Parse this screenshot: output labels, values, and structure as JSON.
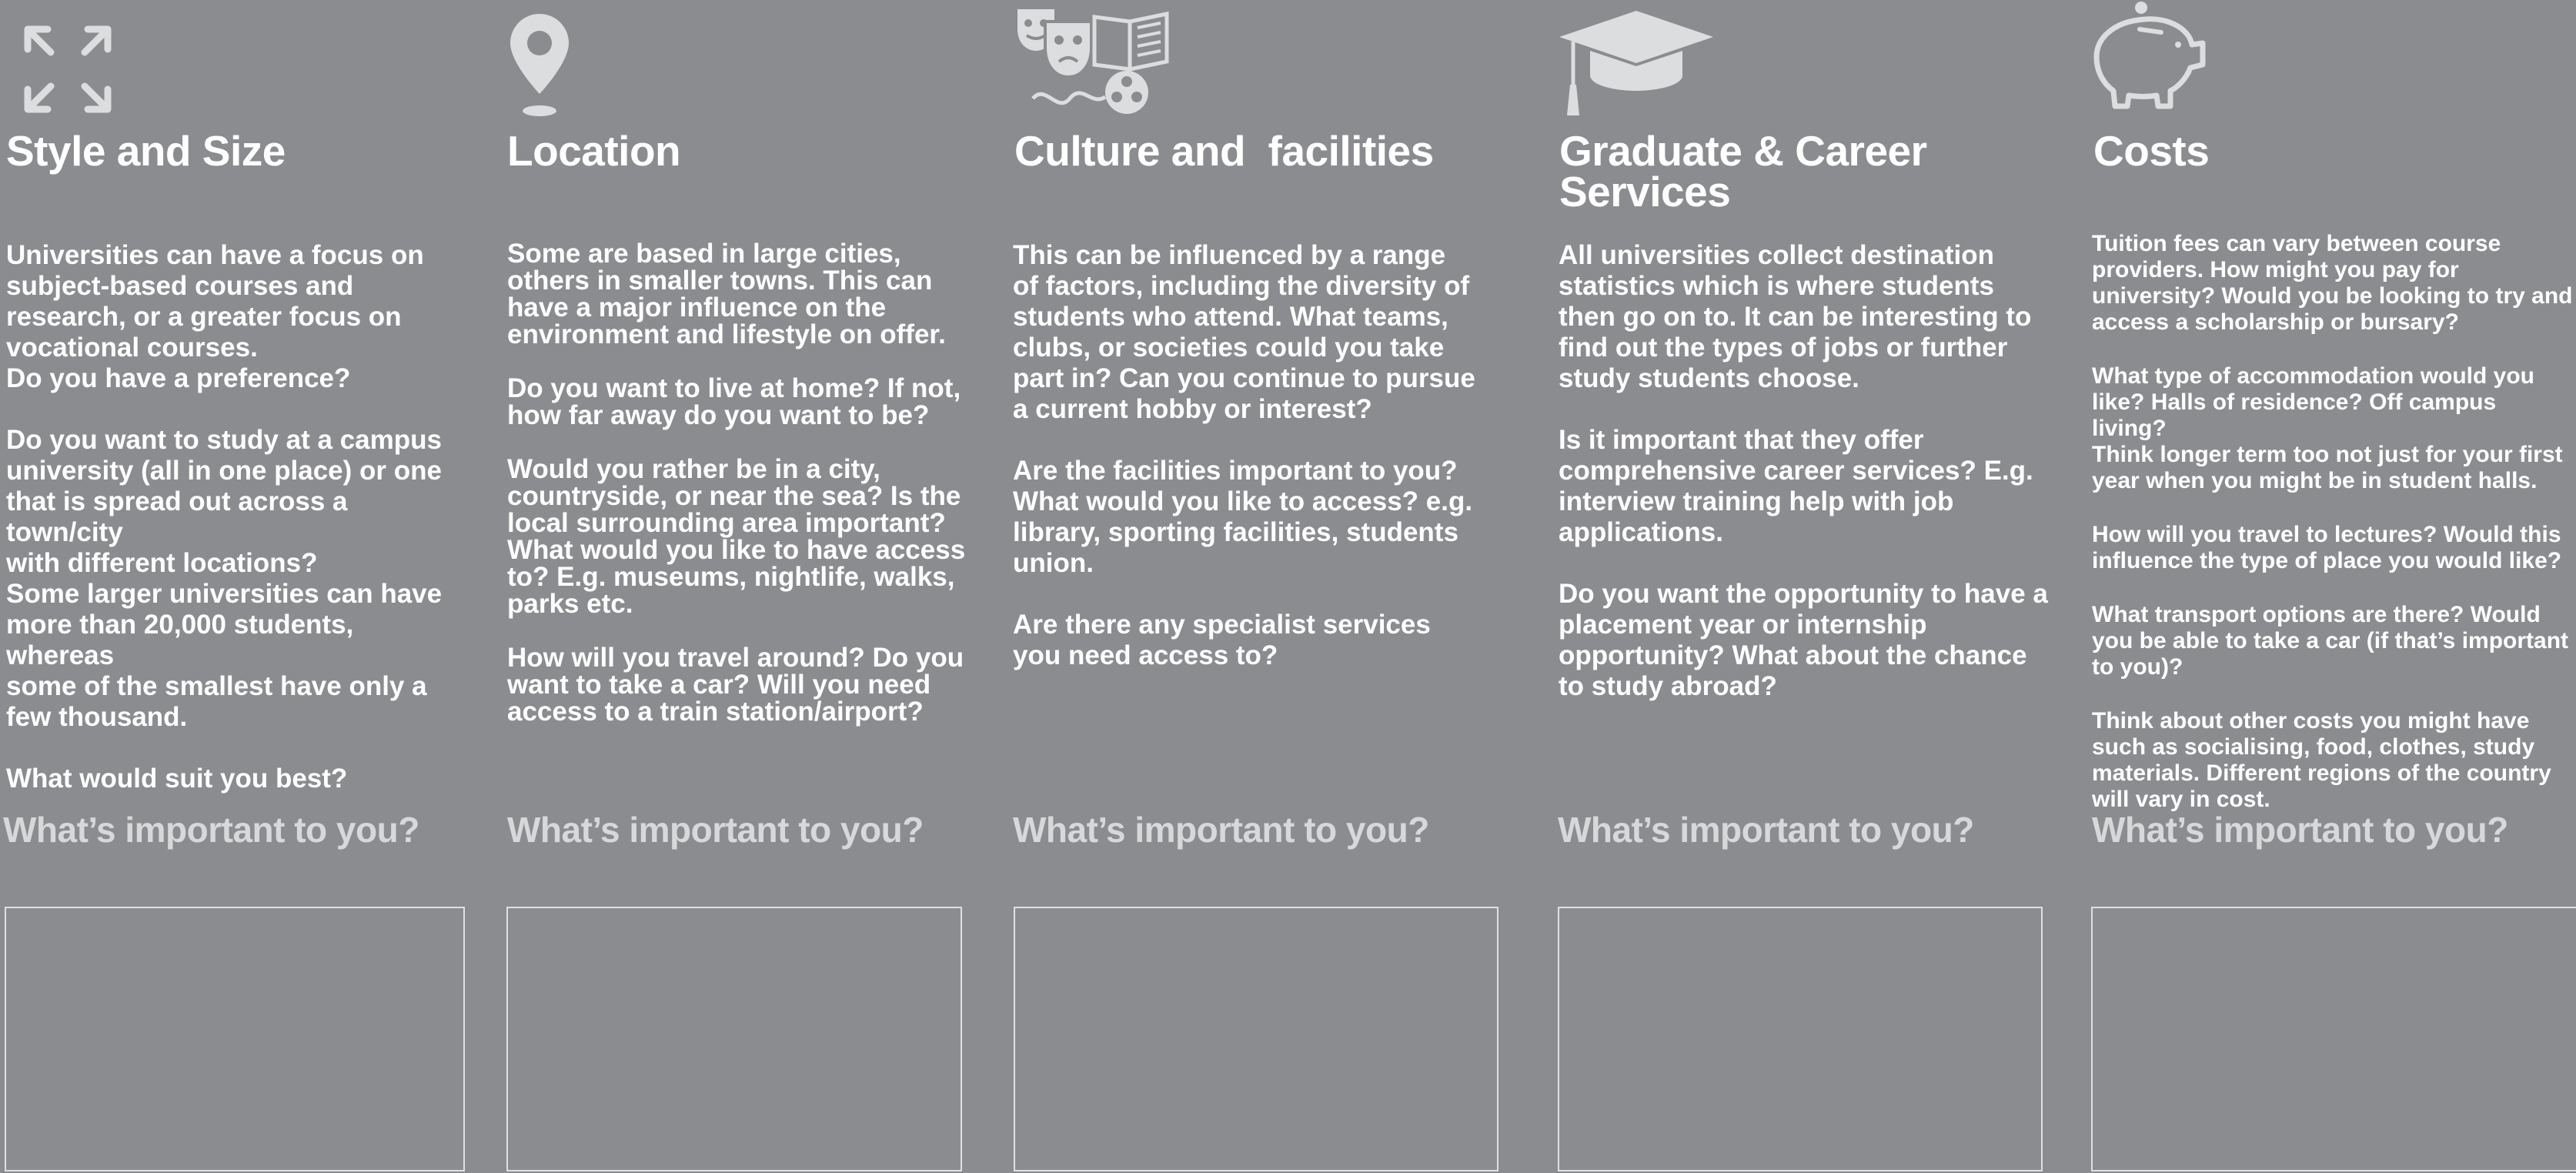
{
  "colors": {
    "background": "#8b8c8f",
    "icon": "#dcdddf",
    "question": "#d7d8da",
    "box_border": "#dfe0e2"
  },
  "columns": [
    {
      "icon": "expand-arrows-icon",
      "title": "Style and Size",
      "paragraphs": [
        "Universities can have a focus on\nsubject-based courses and\nresearch, or a greater focus on\nvocational courses.\nDo you have a preference?",
        "Do you want to study at a campus\nuniversity (all in one place) or one\nthat is spread out across a town/city\nwith different locations?\nSome larger universities can have\nmore than 20,000 students, whereas\nsome of the smallest have only a\nfew thousand.",
        "What would suit you best?"
      ],
      "question": "What’s important to you?"
    },
    {
      "icon": "map-pin-icon",
      "title": "Location",
      "paragraphs": [
        "Some are based in large cities,\nothers in smaller towns. This can\nhave a major influence on the\nenvironment and lifestyle on offer.",
        "Do you want to live at home? If not,\nhow far away do you want to be?",
        "Would you rather be in a city,\ncountryside, or near the sea? Is the\nlocal surrounding area important?\nWhat would you like to have access\nto? E.g. museums, nightlife, walks,\nparks etc.",
        "How will you travel around? Do you\nwant to take a car? Will you need\naccess to a train station/airport?"
      ],
      "question": "What’s important to you?"
    },
    {
      "icon": "culture-masks-film-book-icon",
      "title": "Culture and  facilities",
      "paragraphs": [
        "This can be influenced by a range\nof factors, including the diversity of\nstudents who attend. What teams,\nclubs, or societies could you take\npart in? Can you continue to pursue\na current hobby or interest?",
        "Are the facilities important to you?\nWhat would you like to access? e.g.\nlibrary, sporting facilities, students\nunion.",
        "Are there any specialist services\nyou need access to?"
      ],
      "question": "What’s important to you?"
    },
    {
      "icon": "graduation-cap-icon",
      "title": "Graduate & Career\nServices",
      "paragraphs": [
        "All universities collect destination\nstatistics which is where students\nthen go on to. It can be interesting to\nfind out the types of jobs or further\nstudy students choose.",
        "Is it important that they offer\ncomprehensive career services? E.g.\ninterview training help with job\napplications.",
        "Do you want the opportunity to have a\nplacement year or internship\nopportunity? What about the chance\nto study abroad?"
      ],
      "question": "What’s important to you?"
    },
    {
      "icon": "piggy-bank-icon",
      "title": "Costs",
      "paragraphs": [
        "Tuition fees can vary between course\nproviders. How might you pay for\nuniversity? Would you be looking to try and\naccess a scholarship or bursary?",
        "What type of accommodation would you\nlike? Halls of residence? Off campus living?\nThink longer term too not just for your first\nyear when you might be in student halls.",
        "How will you travel to lectures? Would this\ninfluence the type of place you would like?",
        "What transport options are there? Would\nyou be able to take a car (if that’s important\nto you)?",
        "Think about other costs you might have\nsuch as socialising, food, clothes, study\nmaterials. Different regions of the country\nwill vary in cost."
      ],
      "question": "What’s important to you?"
    }
  ]
}
